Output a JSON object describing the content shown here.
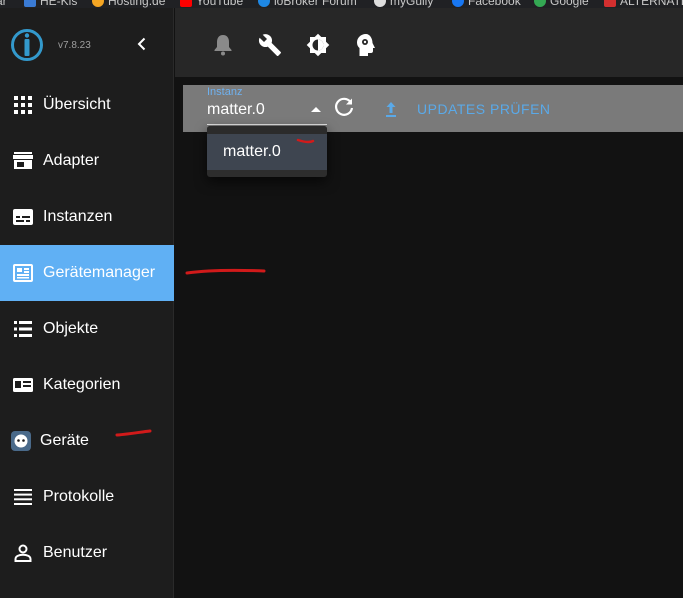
{
  "bookmarks": [
    {
      "label": "ar",
      "color": "#888888"
    },
    {
      "label": "HE-Kis",
      "color": "#3a7bd5"
    },
    {
      "label": "Hosting.de",
      "color": "#f5a623"
    },
    {
      "label": "YouTube",
      "color": "#ff0000"
    },
    {
      "label": "ioBroker Forum",
      "color": "#1e88e5"
    },
    {
      "label": "myGully",
      "color": "#dddddd"
    },
    {
      "label": "Facebook",
      "color": "#1877f2"
    },
    {
      "label": "Google",
      "color": "#34a853"
    },
    {
      "label": "ALTERNATE",
      "color": "#d32f2f"
    }
  ],
  "app": {
    "version": "v7.8.23",
    "logo_color": "#3399cc"
  },
  "sidebar": {
    "items": [
      {
        "label": "Übersicht",
        "icon": "apps-grid-icon"
      },
      {
        "label": "Adapter",
        "icon": "store-icon"
      },
      {
        "label": "Instanzen",
        "icon": "subtitles-icon"
      },
      {
        "label": "Gerätemanager",
        "icon": "device-manager-icon",
        "active": true
      },
      {
        "label": "Objekte",
        "icon": "list-icon"
      },
      {
        "label": "Kategorien",
        "icon": "category-card-icon"
      },
      {
        "label": "Geräte",
        "icon": "devices-robot-icon"
      },
      {
        "label": "Protokolle",
        "icon": "menu-lines-icon"
      },
      {
        "label": "Benutzer",
        "icon": "person-icon"
      }
    ],
    "active_color": "#60b0f4"
  },
  "topbar": {
    "icons": [
      "bell-icon",
      "wrench-icon",
      "brightness-icon",
      "expert-mode-head-icon"
    ]
  },
  "toolbar": {
    "instanz_label": "Instanz",
    "instanz_value": "matter.0",
    "updates_label": "UPDATES PRÜFEN",
    "accent": "#5aa9e8"
  },
  "dropdown": {
    "options": [
      "matter.0"
    ]
  }
}
